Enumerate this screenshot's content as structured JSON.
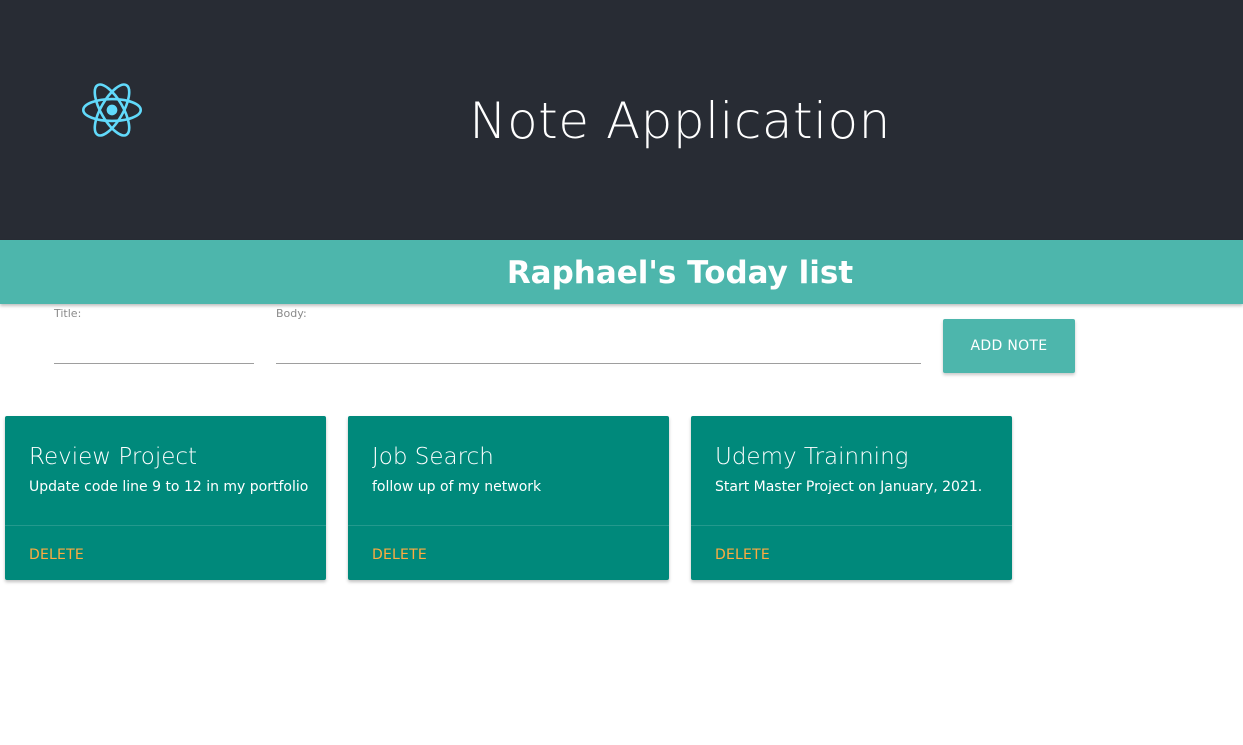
{
  "header": {
    "title": "Note Application",
    "logo_icon": "react-logo-icon",
    "logo_color": "#61dafb",
    "background": "#282c34"
  },
  "subheader": {
    "title": "Raphael's Today list",
    "background": "#4db6ac"
  },
  "form": {
    "title_label": "Title:",
    "title_value": "",
    "body_label": "Body:",
    "body_value": "",
    "add_button_label": "ADD NOTE"
  },
  "notes": [
    {
      "title": "Review Project",
      "body": "Update code line 9 to 12 in my portfolio",
      "action": "DELETE"
    },
    {
      "title": "Job Search",
      "body": "follow up of my network",
      "action": "DELETE"
    },
    {
      "title": "Udemy Trainning",
      "body": "Start Master Project on January, 2021.",
      "action": "DELETE"
    }
  ],
  "colors": {
    "card": "#00897b",
    "delete": "#ffab40",
    "accent": "#4db6ac"
  }
}
